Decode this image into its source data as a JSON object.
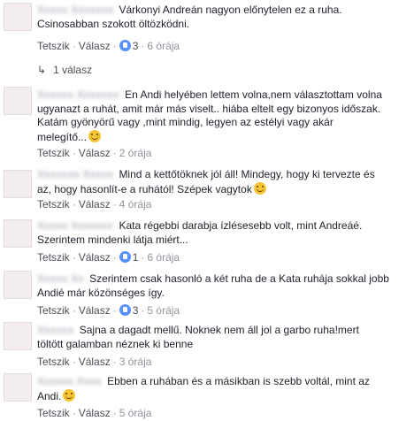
{
  "action_labels": {
    "like": "Tetszik",
    "reply": "Válasz",
    "sep": "·"
  },
  "comments": [
    {
      "author": "Xxxxx Xxxxxxx",
      "lines": [
        "Várkonyi Andreán nagyon előnytelen ez a ruha.",
        "Csinosabban szokott öltözködni."
      ],
      "likes": "3",
      "time": "6 órája"
    },
    {
      "author": "Xxxxxx Xxxxxxx",
      "lines": [
        "En Andi helyében lettem volna,nem választottam volna",
        "ugyanazt a ruhát, amit már más viselt.. hiába eltelt egy bizonyos időszak.",
        "Katám gyönyörű vagy ,mint mindig, legyen az estélyi vagy akár",
        "melegítő..."
      ],
      "time": "2 órája"
    },
    {
      "author": "Xxxxxxx Xxxxx",
      "lines": [
        "Mind a kettőtöknek jól áll! Mindegy, hogy ki tervezte és",
        "az, hogy hasonlít-e a ruhától! Szépek vagytok"
      ],
      "time": "4 órája"
    },
    {
      "author": "Xxxxx Xxxxxxx",
      "lines": [
        "Kata régebbi darabja ízlésesebb volt, mint Andreáé.",
        "Szerintem mindenki látja miért..."
      ],
      "likes": "1",
      "time": "6 órája"
    },
    {
      "author": "Xxxxx Xx",
      "lines": [
        "Szerintem csak hasonló a két ruha de a Kata ruhája sokkal jobb",
        "Andié már közönséges így."
      ],
      "likes": "3",
      "time": "5 órája"
    },
    {
      "author": "Xxxxxx",
      "lines": [
        "Sajna a dagadt mellű. Noknek nem áll jol a garbo ruha!mert",
        "töltött galamban néznek ki benne"
      ],
      "time": "3 órája"
    },
    {
      "author": "Xxxxxx Xxxx",
      "lines": [
        "Ebben a ruhában és a másikban is szebb voltál, mint az",
        "Andi."
      ],
      "time": "5 órája"
    }
  ],
  "replies": {
    "label": "1 válasz",
    "arrow": "↳"
  }
}
